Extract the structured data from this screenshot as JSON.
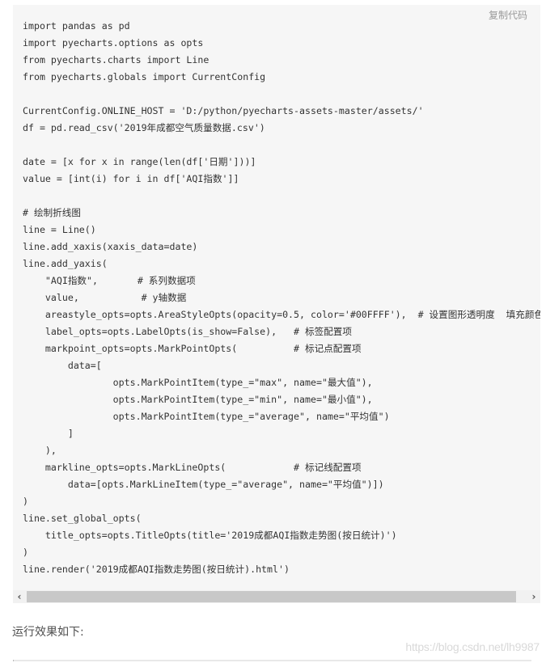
{
  "code_block": {
    "copy_label": "复制代码",
    "lines": [
      "import pandas as pd",
      "import pyecharts.options as opts",
      "from pyecharts.charts import Line",
      "from pyecharts.globals import CurrentConfig",
      "",
      "CurrentConfig.ONLINE_HOST = 'D:/python/pyecharts-assets-master/assets/'",
      "df = pd.read_csv('2019年成都空气质量数据.csv')",
      "",
      "date = [x for x in range(len(df['日期']))]",
      "value = [int(i) for i in df['AQI指数']]",
      "",
      "# 绘制折线图",
      "line = Line()",
      "line.add_xaxis(xaxis_data=date)",
      "line.add_yaxis(",
      "    \"AQI指数\",       # 系列数据项",
      "    value,           # y轴数据",
      "    areastyle_opts=opts.AreaStyleOpts(opacity=0.5, color='#00FFFF'),  # 设置图形透明度  填充颜色",
      "    label_opts=opts.LabelOpts(is_show=False),   # 标签配置项",
      "    markpoint_opts=opts.MarkPointOpts(          # 标记点配置项",
      "        data=[",
      "                opts.MarkPointItem(type_=\"max\", name=\"最大值\"),",
      "                opts.MarkPointItem(type_=\"min\", name=\"最小值\"),",
      "                opts.MarkPointItem(type_=\"average\", name=\"平均值\")",
      "        ]",
      "    ),",
      "    markline_opts=opts.MarkLineOpts(            # 标记线配置项",
      "        data=[opts.MarkLineItem(type_=\"average\", name=\"平均值\")])",
      ")",
      "line.set_global_opts(",
      "    title_opts=opts.TitleOpts(title='2019成都AQI指数走势图(按日统计)')",
      ")",
      "line.render('2019成都AQI指数走势图(按日统计).html')"
    ]
  },
  "scrollbar": {
    "left_arrow": "‹",
    "right_arrow": "›",
    "position_fraction": 0.0
  },
  "result_text": "运行效果如下:",
  "watermark": "https://blog.csdn.net/lh9987"
}
